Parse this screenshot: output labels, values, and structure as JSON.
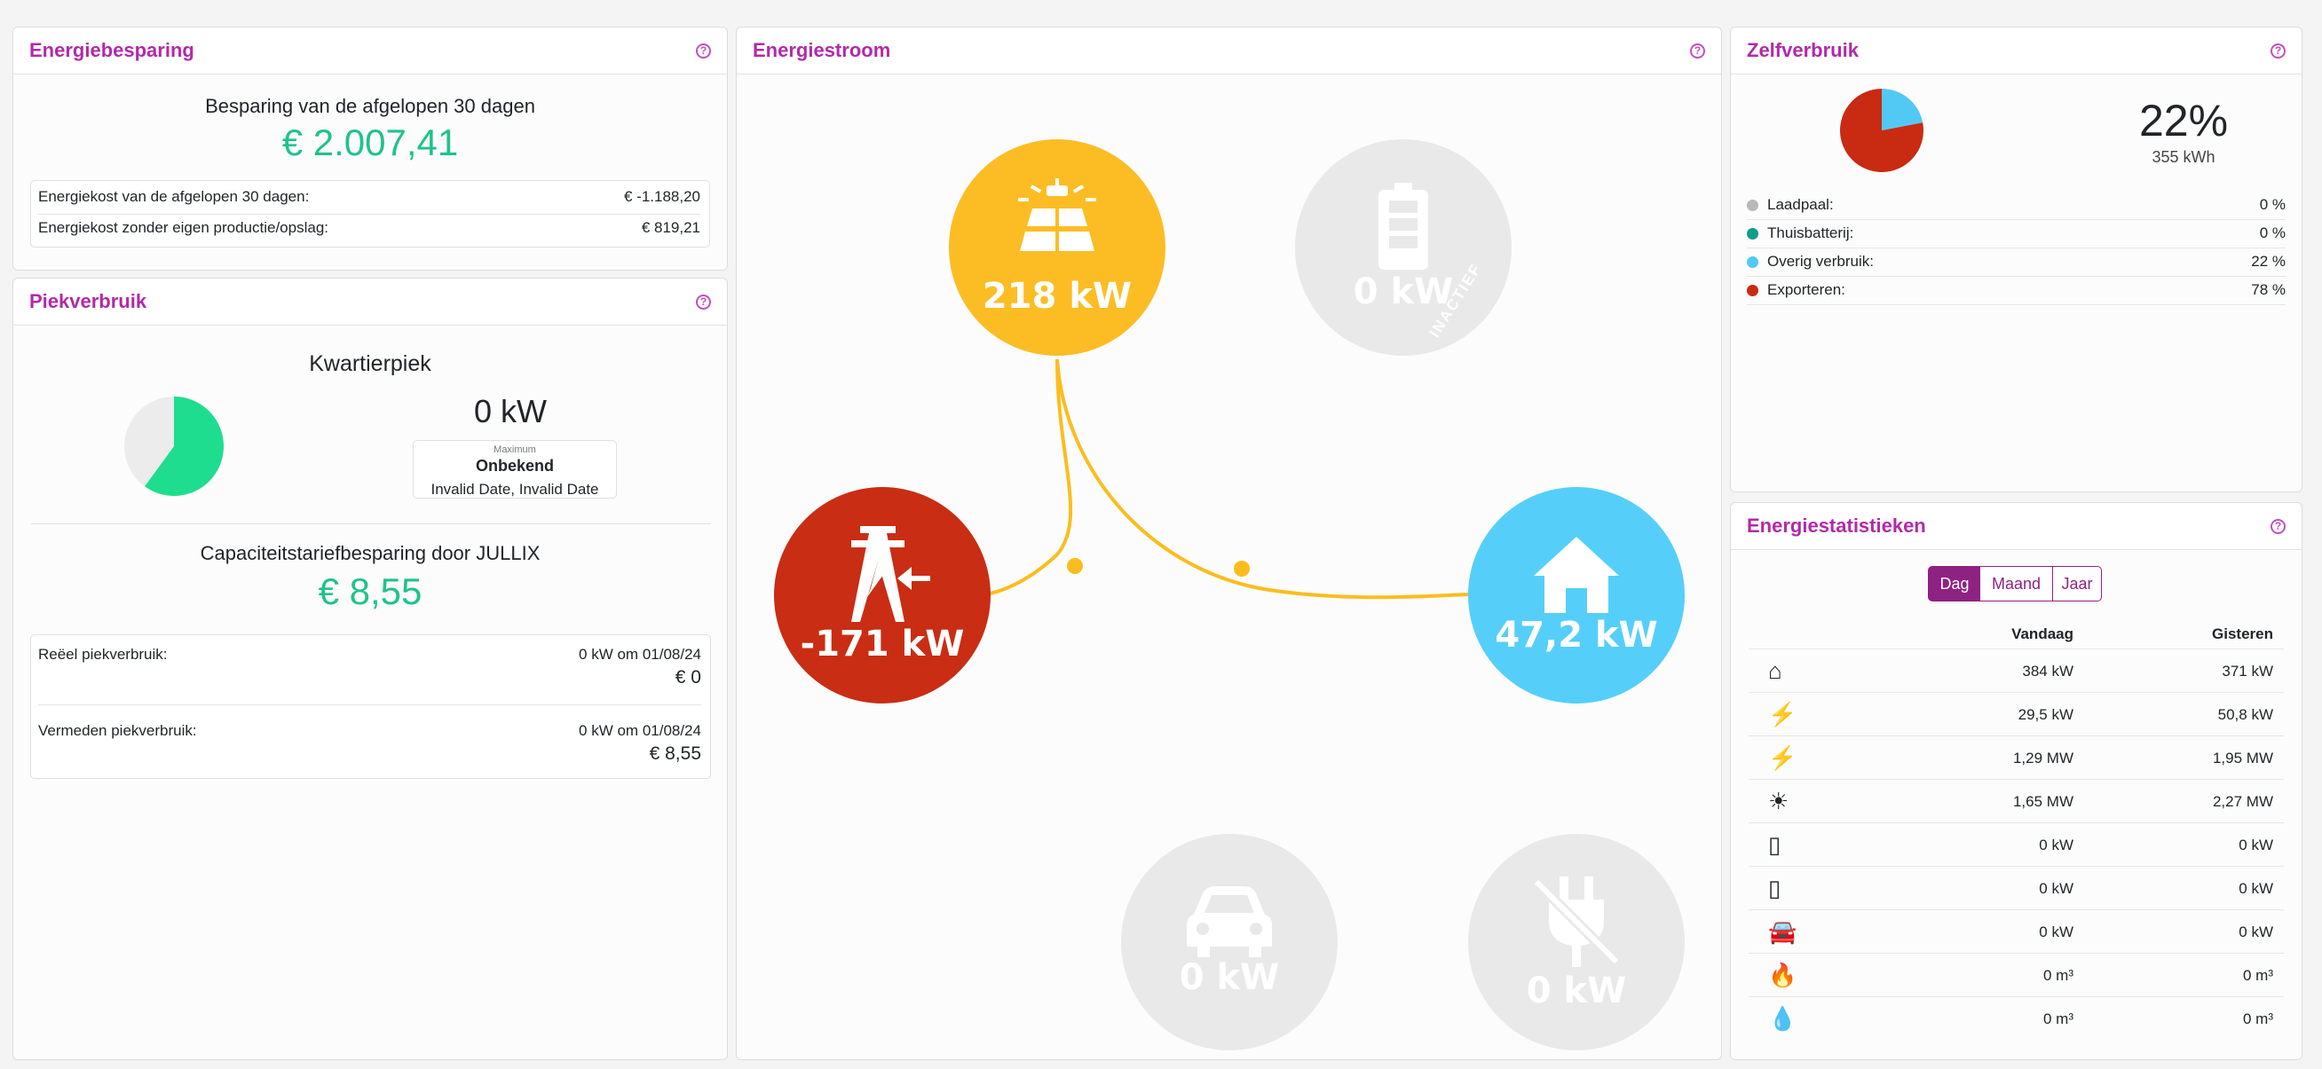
{
  "savings": {
    "title": "Energiebesparing",
    "heading": "Besparing van de afgelopen 30 dagen",
    "amount": "€ 2.007,41",
    "rows": [
      {
        "label": "Energiekost van de afgelopen 30 dagen:",
        "value": "€ -1.188,20"
      },
      {
        "label": "Energiekost zonder eigen productie/opslag:",
        "value": "€ 819,21"
      }
    ]
  },
  "peak": {
    "title": "Piekverbruik",
    "heading": "Kwartierpiek",
    "value": "0 kW",
    "max_label": "Maximum",
    "max_value": "Onbekend",
    "max_date": "Invalid Date, Invalid Date",
    "cap_heading": "Capaciteitstariefbesparing door JULLIX",
    "cap_amount": "€ 8,55",
    "real_label": "Reëel piekverbruik:",
    "real_when": "0 kW om 01/08/24",
    "real_cost": "€ 0",
    "avoided_label": "Vermeden piekverbruik:",
    "avoided_when": "0 kW om 01/08/24",
    "avoided_cost": "€ 8,55",
    "gauge_fraction": 0.6
  },
  "flow": {
    "title": "Energiestroom",
    "solar": "218 kW",
    "battery": "0 kW",
    "battery_status": "INACTIEF",
    "grid": "-171 kW",
    "home": "47,2 kW",
    "car": "0 kW",
    "charger": "0 kW"
  },
  "self": {
    "title": "Zelfverbruik",
    "percent": "22%",
    "kwh": "355 kWh",
    "legend": [
      {
        "label": "Laadpaal:",
        "value": "0 %",
        "color": "#b8b8b8"
      },
      {
        "label": "Thuisbatterij:",
        "value": "0 %",
        "color": "#0f9d8a"
      },
      {
        "label": "Overig verbruik:",
        "value": "22 %",
        "color": "#52c9f5"
      },
      {
        "label": "Exporteren:",
        "value": "78 %",
        "color": "#c92a12"
      }
    ]
  },
  "stats": {
    "title": "Energiestatistieken",
    "tabs": [
      "Dag",
      "Maand",
      "Jaar"
    ],
    "col_today": "Vandaag",
    "col_yesterday": "Gisteren",
    "rows": [
      {
        "icon": "home-icon",
        "today": "384 kW",
        "yesterday": "371 kW"
      },
      {
        "icon": "grid-import-icon",
        "today": "29,5 kW",
        "yesterday": "50,8 kW"
      },
      {
        "icon": "grid-export-icon",
        "today": "1,29 MW",
        "yesterday": "1,95 MW"
      },
      {
        "icon": "solar-icon",
        "today": "1,65 MW",
        "yesterday": "2,27 MW"
      },
      {
        "icon": "battery-charge-icon",
        "today": "0 kW",
        "yesterday": "0 kW"
      },
      {
        "icon": "battery-discharge-icon",
        "today": "0 kW",
        "yesterday": "0 kW"
      },
      {
        "icon": "car-icon",
        "today": "0 kW",
        "yesterday": "0 kW"
      },
      {
        "icon": "gas-icon",
        "today": "0 m³",
        "yesterday": "0 m³"
      },
      {
        "icon": "water-icon",
        "today": "0 m³",
        "yesterday": "0 m³"
      }
    ]
  }
}
